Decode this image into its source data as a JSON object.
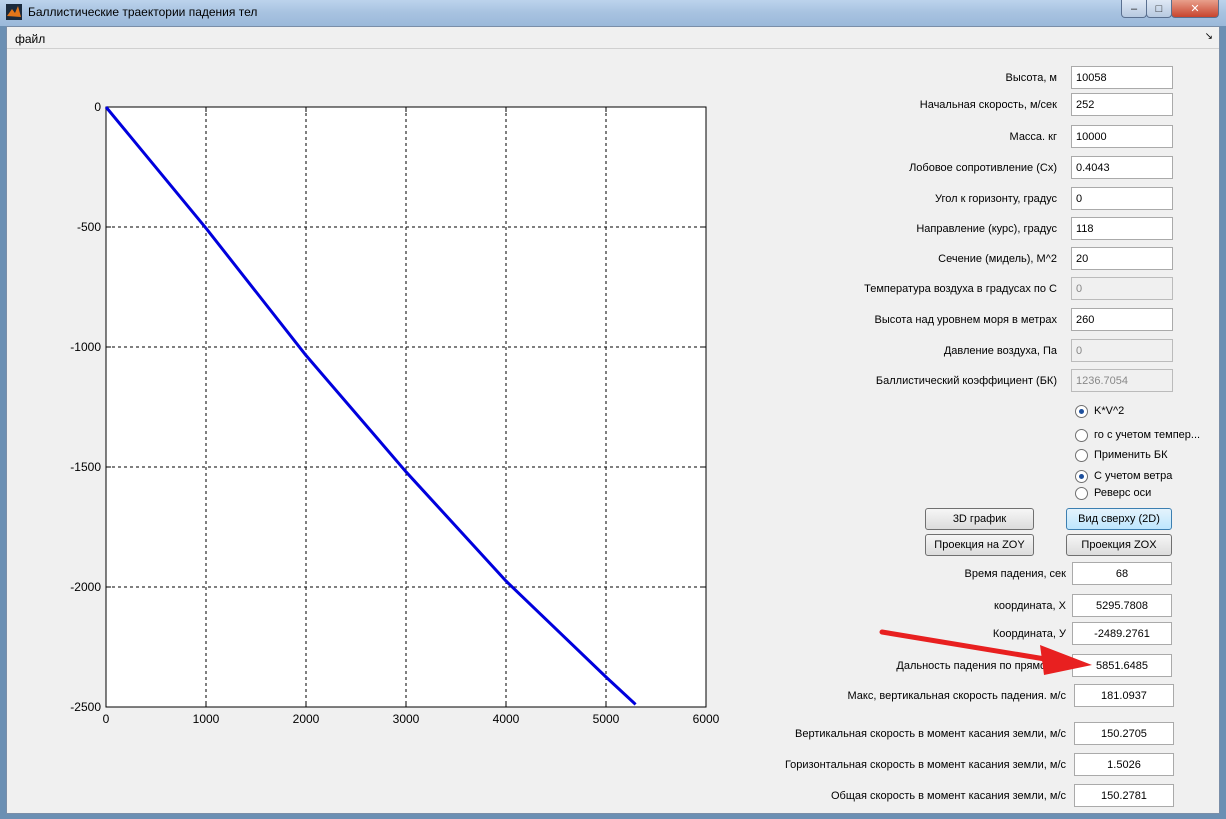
{
  "window": {
    "title": "Баллистические траектории падения тел",
    "menu_file": "файл",
    "menu_corner": "↘",
    "close_glyph": "✕",
    "max_glyph": "□",
    "min_glyph": "–"
  },
  "inputs": [
    {
      "label": "Высота, м",
      "value": "10058",
      "disabled": false
    },
    {
      "label": "Начальная скорость, м/сек",
      "value": "252",
      "disabled": false
    },
    {
      "label": "Масса. кг",
      "value": "10000",
      "disabled": false
    },
    {
      "label": "Лобовое сопротивление (Cx)",
      "value": "0.4043",
      "disabled": false
    },
    {
      "label": "Угол к горизонту, градус",
      "value": "0",
      "disabled": false
    },
    {
      "label": "Направление  (курс), градус",
      "value": "118",
      "disabled": false
    },
    {
      "label": "Сечение (мидель), М^2",
      "value": "20",
      "disabled": false
    },
    {
      "label": "Температура воздуха в градусах по С",
      "value": "0",
      "disabled": true
    },
    {
      "label": "Высота над уровнем моря в метрах",
      "value": "260",
      "disabled": false
    },
    {
      "label": "Давление воздуха, Па",
      "value": "0",
      "disabled": true
    },
    {
      "label": "Баллистический коэффициент (БК)",
      "value": "1236.7054",
      "disabled": true
    }
  ],
  "options": [
    {
      "label": "K*V^2",
      "checked": true
    },
    {
      "label": "го с учетом темпер...",
      "checked": false
    },
    {
      "label": "Применить БК",
      "checked": false
    },
    {
      "label": "С учетом ветра",
      "checked": true
    },
    {
      "label": "Реверс оси",
      "checked": false
    }
  ],
  "buttons": {
    "plot3d": "3D график",
    "top_view": "Вид сверху (2D)",
    "proj_zoy": "Проекция на ZOY",
    "proj_zox": "Проекция ZOX"
  },
  "results": [
    {
      "label": "Время падения, сек",
      "value": "68"
    },
    {
      "label": "координата, Х",
      "value": "5295.7808"
    },
    {
      "label": "Координата, У",
      "value": "-2489.2761"
    },
    {
      "label": "Дальность падения по прямой, м",
      "value": "5851.6485"
    },
    {
      "label": "Макс,  вертикальная скорость падения. м/с",
      "value": "181.0937"
    },
    {
      "label": "Вертикальная  скорость в момент касания земли, м/с",
      "value": "150.2705"
    },
    {
      "label": "Горизонтальная скорость в момент касания земли, м/с",
      "value": "1.5026"
    },
    {
      "label": "Общая скорость в момент касания земли, м/с",
      "value": "150.2781"
    }
  ],
  "colors": {
    "trajectory": "#0000dd",
    "annotation_arrow": "#e82020",
    "grid": "#000000"
  },
  "chart_data": {
    "type": "line",
    "title": "",
    "xlabel": "",
    "ylabel": "",
    "xlim": [
      0,
      6000
    ],
    "ylim": [
      -2500,
      0
    ],
    "x_ticks": [
      "0",
      "1000",
      "2000",
      "3000",
      "4000",
      "5000",
      "6000"
    ],
    "y_ticks": [
      "0",
      "-500",
      "-1000",
      "-1500",
      "-2000",
      "-2500"
    ],
    "grid": true,
    "series": [
      {
        "x": [
          0,
          1000,
          2000,
          3000,
          4000,
          5000,
          5295.7808
        ],
        "y": [
          0,
          -505,
          -1035,
          -1520,
          -1975,
          -2375,
          -2489.2761
        ]
      }
    ]
  }
}
